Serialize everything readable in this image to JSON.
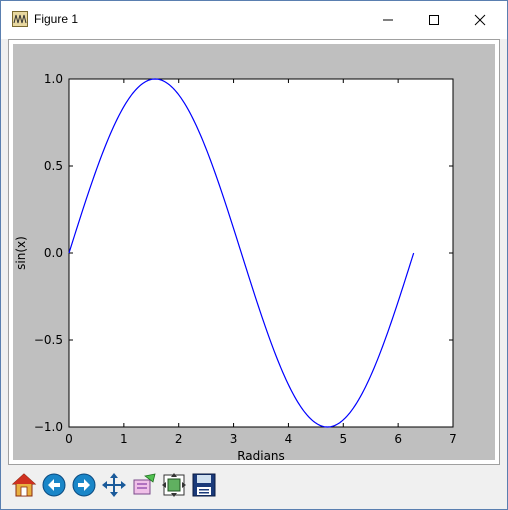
{
  "window": {
    "title": "Figure 1"
  },
  "controls": {
    "minimize_icon": "minimize-icon",
    "maximize_icon": "maximize-icon",
    "close_icon": "close-icon"
  },
  "toolbar": {
    "buttons": [
      {
        "icon": "home-icon"
      },
      {
        "icon": "back-arrow-icon"
      },
      {
        "icon": "forward-arrow-icon"
      },
      {
        "icon": "pan-icon"
      },
      {
        "icon": "zoom-rect-icon"
      },
      {
        "icon": "configure-subplots-icon"
      },
      {
        "icon": "save-icon"
      }
    ]
  },
  "colors": {
    "line": "#0000ff",
    "figure_background": "#bfbfbf",
    "axes_background": "#ffffff"
  },
  "chart_data": {
    "type": "line",
    "function": "sin(x)",
    "xlabel": "Radians",
    "ylabel": "sin(x)",
    "xlim": [
      0,
      7
    ],
    "ylim": [
      -1.0,
      1.0
    ],
    "xticks": [
      0,
      1,
      2,
      3,
      4,
      5,
      6,
      7
    ],
    "xtick_labels": [
      "0",
      "1",
      "2",
      "3",
      "4",
      "5",
      "6",
      "7"
    ],
    "yticks": [
      -1.0,
      -0.5,
      0.0,
      0.5,
      1.0
    ],
    "ytick_labels": [
      "−1.0",
      "−0.5",
      "0.0",
      "0.5",
      "1.0"
    ],
    "x_range": [
      0,
      6.283
    ],
    "series": [
      {
        "color": "#0000ff",
        "x": [
          0,
          0.5,
          1.0,
          1.5708,
          2.0,
          2.5,
          3.1416,
          3.5,
          4.0,
          4.7124,
          5.0,
          5.5,
          6.283
        ],
        "y": [
          0,
          0.479,
          0.841,
          1.0,
          0.909,
          0.598,
          0.0,
          -0.351,
          -0.757,
          -1.0,
          -0.959,
          -0.706,
          0.0
        ]
      }
    ],
    "grid": false,
    "legend": "none"
  }
}
